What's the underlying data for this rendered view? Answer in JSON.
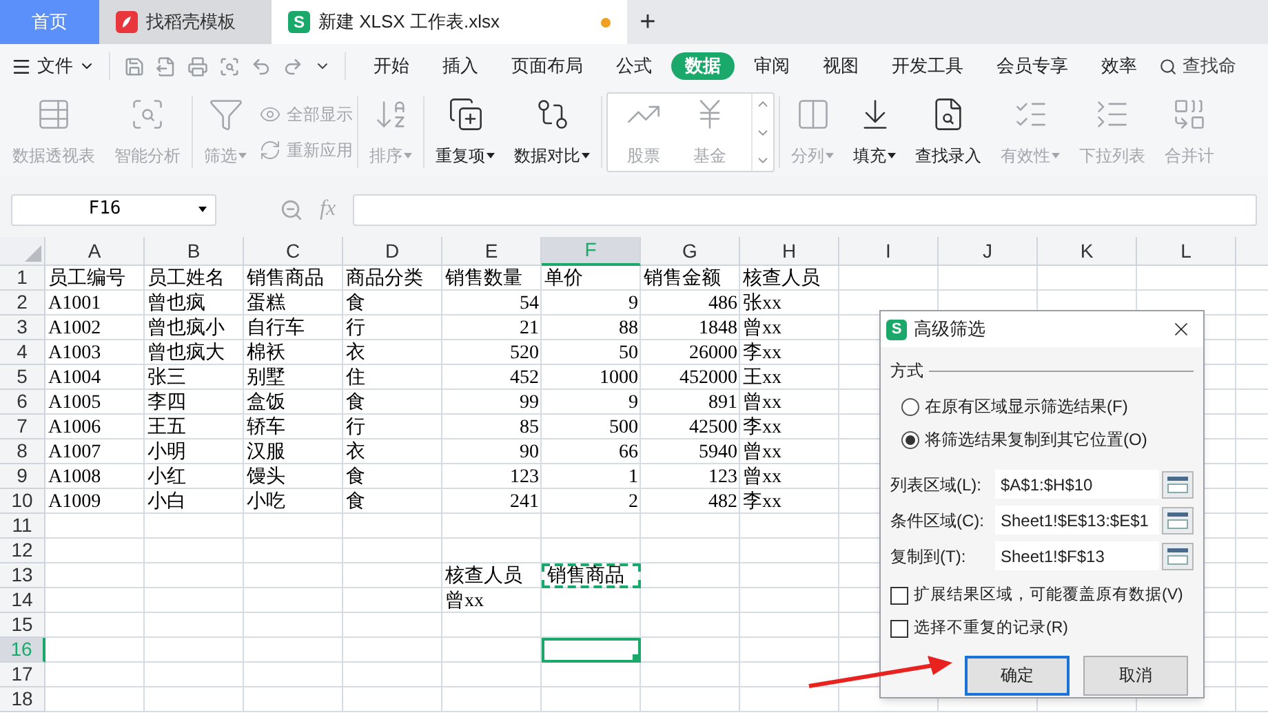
{
  "tabs": [
    {
      "label": "首页",
      "kind": "home",
      "selected": false
    },
    {
      "label": "找稻壳模板",
      "kind": "template",
      "selected": false
    },
    {
      "label": "新建 XLSX 工作表.xlsx",
      "kind": "workbook",
      "selected": true,
      "unsaved": true,
      "logo": "S"
    }
  ],
  "new_tab": "+",
  "menu": {
    "file": "文件",
    "tabs": [
      {
        "label": "开始",
        "selected": false
      },
      {
        "label": "插入",
        "selected": false
      },
      {
        "label": "页面布局",
        "selected": false
      },
      {
        "label": "公式",
        "selected": false
      },
      {
        "label": "数据",
        "selected": true
      },
      {
        "label": "审阅",
        "selected": false
      },
      {
        "label": "视图",
        "selected": false
      },
      {
        "label": "开发工具",
        "selected": false
      },
      {
        "label": "会员专享",
        "selected": false
      },
      {
        "label": "效率",
        "selected": false
      }
    ],
    "search": "查找命"
  },
  "ribbon": [
    {
      "kind": "plain",
      "items": [
        {
          "label": "数据透视表",
          "kind": "large",
          "disabled": true,
          "dropdown": false
        },
        {
          "label": "智能分析",
          "kind": "large",
          "disabled": true,
          "dropdown": false
        }
      ]
    },
    {
      "kind": "plain",
      "items": [
        {
          "label": "筛选",
          "kind": "large",
          "disabled": true,
          "dropdown": true
        },
        {
          "label": "全部显示",
          "kind": "small",
          "disabled": true,
          "dropdown": false
        },
        {
          "label": "重新应用",
          "kind": "small",
          "disabled": true,
          "dropdown": false
        }
      ]
    },
    {
      "kind": "plain",
      "items": [
        {
          "label": "排序",
          "kind": "large",
          "disabled": true,
          "dropdown": true
        }
      ]
    },
    {
      "kind": "plain",
      "items": [
        {
          "label": "重复项",
          "kind": "large",
          "disabled": false,
          "dropdown": true
        },
        {
          "label": "数据对比",
          "kind": "large",
          "disabled": false,
          "dropdown": true
        }
      ]
    },
    {
      "kind": "gallery",
      "items": [
        {
          "label": "股票",
          "kind": "large",
          "disabled": true,
          "dropdown": false
        },
        {
          "label": "基金",
          "kind": "large",
          "disabled": true,
          "dropdown": false
        }
      ]
    },
    {
      "kind": "plain",
      "items": [
        {
          "label": "分列",
          "kind": "large",
          "disabled": true,
          "dropdown": true
        },
        {
          "label": "填充",
          "kind": "large",
          "disabled": false,
          "dropdown": true
        },
        {
          "label": "查找录入",
          "kind": "large",
          "disabled": false,
          "dropdown": false
        },
        {
          "label": "有效性",
          "kind": "large",
          "disabled": true,
          "dropdown": true
        },
        {
          "label": "下拉列表",
          "kind": "large",
          "disabled": true,
          "dropdown": false
        },
        {
          "label": "合并计",
          "kind": "large",
          "disabled": true,
          "dropdown": false
        }
      ]
    }
  ],
  "name_box": "F16",
  "function_label": "fx",
  "sheet": {
    "columns": [
      {
        "label": "A",
        "selected": false
      },
      {
        "label": "B",
        "selected": false
      },
      {
        "label": "C",
        "selected": false
      },
      {
        "label": "D",
        "selected": false
      },
      {
        "label": "E",
        "selected": false
      },
      {
        "label": "F",
        "selected": true
      },
      {
        "label": "G",
        "selected": false
      },
      {
        "label": "H",
        "selected": false
      },
      {
        "label": "I",
        "selected": false
      },
      {
        "label": "J",
        "selected": false
      },
      {
        "label": "K",
        "selected": false
      },
      {
        "label": "L",
        "selected": false
      }
    ],
    "rows": [
      {
        "number": "1",
        "selected": false,
        "cells": [
          {
            "text": "员工编号",
            "kind": "text"
          },
          {
            "text": "员工姓名",
            "kind": "text"
          },
          {
            "text": "销售商品",
            "kind": "text"
          },
          {
            "text": "商品分类",
            "kind": "text"
          },
          {
            "text": "销售数量",
            "kind": "text"
          },
          {
            "text": "单价",
            "kind": "text"
          },
          {
            "text": "销售金额",
            "kind": "text"
          },
          {
            "text": "核查人员",
            "kind": "text"
          }
        ]
      },
      {
        "number": "2",
        "selected": false,
        "cells": [
          {
            "text": "A1001",
            "kind": "text"
          },
          {
            "text": "曾也疯",
            "kind": "text"
          },
          {
            "text": "蛋糕",
            "kind": "text"
          },
          {
            "text": "食",
            "kind": "text"
          },
          {
            "text": "54",
            "kind": "number"
          },
          {
            "text": "9",
            "kind": "number"
          },
          {
            "text": "486",
            "kind": "number"
          },
          {
            "text": "张xx",
            "kind": "text"
          }
        ]
      },
      {
        "number": "3",
        "selected": false,
        "cells": [
          {
            "text": "A1002",
            "kind": "text"
          },
          {
            "text": "曾也疯小",
            "kind": "text"
          },
          {
            "text": "自行车",
            "kind": "text"
          },
          {
            "text": "行",
            "kind": "text"
          },
          {
            "text": "21",
            "kind": "number"
          },
          {
            "text": "88",
            "kind": "number"
          },
          {
            "text": "1848",
            "kind": "number"
          },
          {
            "text": "曾xx",
            "kind": "text"
          }
        ]
      },
      {
        "number": "4",
        "selected": false,
        "cells": [
          {
            "text": "A1003",
            "kind": "text"
          },
          {
            "text": "曾也疯大",
            "kind": "text"
          },
          {
            "text": "棉袄",
            "kind": "text"
          },
          {
            "text": "衣",
            "kind": "text"
          },
          {
            "text": "520",
            "kind": "number"
          },
          {
            "text": "50",
            "kind": "number"
          },
          {
            "text": "26000",
            "kind": "number"
          },
          {
            "text": "李xx",
            "kind": "text"
          }
        ]
      },
      {
        "number": "5",
        "selected": false,
        "cells": [
          {
            "text": "A1004",
            "kind": "text"
          },
          {
            "text": "张三",
            "kind": "text"
          },
          {
            "text": "别墅",
            "kind": "text"
          },
          {
            "text": "住",
            "kind": "text"
          },
          {
            "text": "452",
            "kind": "number"
          },
          {
            "text": "1000",
            "kind": "number"
          },
          {
            "text": "452000",
            "kind": "number"
          },
          {
            "text": "王xx",
            "kind": "text"
          }
        ]
      },
      {
        "number": "6",
        "selected": false,
        "cells": [
          {
            "text": "A1005",
            "kind": "text"
          },
          {
            "text": "李四",
            "kind": "text"
          },
          {
            "text": "盒饭",
            "kind": "text"
          },
          {
            "text": "食",
            "kind": "text"
          },
          {
            "text": "99",
            "kind": "number"
          },
          {
            "text": "9",
            "kind": "number"
          },
          {
            "text": "891",
            "kind": "number"
          },
          {
            "text": "曾xx",
            "kind": "text"
          }
        ]
      },
      {
        "number": "7",
        "selected": false,
        "cells": [
          {
            "text": "A1006",
            "kind": "text"
          },
          {
            "text": "王五",
            "kind": "text"
          },
          {
            "text": "轿车",
            "kind": "text"
          },
          {
            "text": "行",
            "kind": "text"
          },
          {
            "text": "85",
            "kind": "number"
          },
          {
            "text": "500",
            "kind": "number"
          },
          {
            "text": "42500",
            "kind": "number"
          },
          {
            "text": "李xx",
            "kind": "text"
          }
        ]
      },
      {
        "number": "8",
        "selected": false,
        "cells": [
          {
            "text": "A1007",
            "kind": "text"
          },
          {
            "text": "小明",
            "kind": "text"
          },
          {
            "text": "汉服",
            "kind": "text"
          },
          {
            "text": "衣",
            "kind": "text"
          },
          {
            "text": "90",
            "kind": "number"
          },
          {
            "text": "66",
            "kind": "number"
          },
          {
            "text": "5940",
            "kind": "number"
          },
          {
            "text": "曾xx",
            "kind": "text"
          }
        ]
      },
      {
        "number": "9",
        "selected": false,
        "cells": [
          {
            "text": "A1008",
            "kind": "text"
          },
          {
            "text": "小红",
            "kind": "text"
          },
          {
            "text": "馒头",
            "kind": "text"
          },
          {
            "text": "食",
            "kind": "text"
          },
          {
            "text": "123",
            "kind": "number"
          },
          {
            "text": "1",
            "kind": "number"
          },
          {
            "text": "123",
            "kind": "number"
          },
          {
            "text": "曾xx",
            "kind": "text"
          }
        ]
      },
      {
        "number": "10",
        "selected": false,
        "cells": [
          {
            "text": "A1009",
            "kind": "text"
          },
          {
            "text": "小白",
            "kind": "text"
          },
          {
            "text": "小吃",
            "kind": "text"
          },
          {
            "text": "食",
            "kind": "text"
          },
          {
            "text": "241",
            "kind": "number"
          },
          {
            "text": "2",
            "kind": "number"
          },
          {
            "text": "482",
            "kind": "number"
          },
          {
            "text": "李xx",
            "kind": "text"
          }
        ]
      },
      {
        "number": "11",
        "selected": false
      },
      {
        "number": "12",
        "selected": false
      },
      {
        "number": "13",
        "selected": false,
        "cells": [
          {
            "kind": "empty"
          },
          {
            "kind": "empty"
          },
          {
            "kind": "empty"
          },
          {
            "kind": "empty"
          },
          {
            "text": "核查人员",
            "kind": "text"
          },
          {
            "text": "销售商品",
            "kind": "copied"
          }
        ]
      },
      {
        "number": "14",
        "selected": false,
        "cells": [
          {
            "kind": "empty"
          },
          {
            "kind": "empty"
          },
          {
            "kind": "empty"
          },
          {
            "kind": "empty"
          },
          {
            "text": "曾xx",
            "kind": "text"
          }
        ]
      },
      {
        "number": "15",
        "selected": false
      },
      {
        "number": "16",
        "selected": true
      },
      {
        "number": "17",
        "selected": false
      },
      {
        "number": "18",
        "selected": false
      }
    ]
  },
  "dialog": {
    "logo": "S",
    "title": "高级筛选",
    "section": "方式",
    "options": [
      {
        "label": "在原有区域显示筛选结果(F)",
        "selected": false
      },
      {
        "label": "将筛选结果复制到其它位置(O)",
        "selected": true
      }
    ],
    "fields": [
      {
        "label": "列表区域(L):",
        "value": "$A$1:$H$10"
      },
      {
        "label": "条件区域(C):",
        "value": "Sheet1!$E$13:$E$1"
      },
      {
        "label": "复制到(T):",
        "value": "Sheet1!$F$13"
      }
    ],
    "checks": [
      {
        "label": "扩展结果区域，可能覆盖原有数据(V)",
        "checked": false
      },
      {
        "label": "选择不重复的记录(R)",
        "checked": false
      }
    ],
    "buttons": [
      {
        "label": "确定",
        "default": true
      },
      {
        "label": "取消",
        "default": false
      }
    ]
  }
}
